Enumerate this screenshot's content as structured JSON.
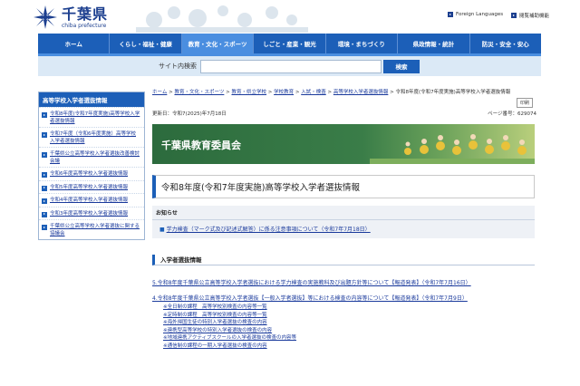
{
  "header": {
    "logo_jp": "千葉県",
    "logo_en": "chiba prefecture",
    "utility_links": [
      "Foreign Languages",
      "閲覧補助機能"
    ]
  },
  "nav": {
    "items": [
      "ホーム",
      "くらし・福祉・健康",
      "教育・文化・スポーツ",
      "しごと・産業・観光",
      "環境・まちづくり",
      "県政情報・統計",
      "防災・安全・安心"
    ],
    "active_index": 2
  },
  "search": {
    "label": "サイト内検索",
    "placeholder": "",
    "button": "検索"
  },
  "sidebar": {
    "title": "高等学校入学者選抜情報",
    "items": [
      {
        "label": "令和8年度(令和7年度実施)高等学校入学者選抜情報"
      },
      {
        "label": "令和7年度（令和6年度実施）高等学校入学者選抜情報"
      },
      {
        "label": "千葉県公立高等学校入学者選抜改善検討会議"
      },
      {
        "label": "令和6年度高等学校入学者選抜情報"
      },
      {
        "label": "令和5年度高等学校入学者選抜情報"
      },
      {
        "label": "令和4年度高等学校入学者選抜情報"
      },
      {
        "label": "令和3年度高等学校入学者選抜情報"
      },
      {
        "label": "千葉県公立高等学校入学者選抜に関する協議会"
      }
    ]
  },
  "main": {
    "breadcrumb": [
      "ホーム",
      "教育・文化・スポーツ",
      "教育・県立学校",
      "学校教育",
      "入試・検査",
      "高等学校入学者選抜情報",
      "令和8年度(令和7年度実施)高等学校入学者選抜情報"
    ],
    "updated": "更新日：令和7(2025)年7月18日",
    "page_number": "ページ番号：629074",
    "print_label": "印刷",
    "banner_title": "千葉県教育委員会",
    "page_title": "令和8年度(令和7年度実施)高等学校入学者選抜情報",
    "notice": {
      "heading": "お知らせ",
      "link": "学力検査（マーク式及び記述式解答）に係る注意事項について（令和7年7月18日）"
    },
    "section": {
      "heading": "入学者選抜情報",
      "item5": "5.令和8年度千葉県公立高等学校入学者選抜における学力検査の実施教科及び出題方針等について【報道発表】（令和7年7月16日）",
      "item4": "4.令和8年度千葉県公立高等学校入学者選抜【一般入学者選抜】等における検査の内容等について【報道発表】（令和7年7月9日）",
      "sub_items": [
        "※全日制の課程　高等学校別検査の内容等一覧",
        "※定時制の課程　高等学校別検査の内容等一覧",
        "※海外帰国生徒の特別入学者選抜の検査の内容",
        "※連携型高等学校の特別入学者選抜の検査の内容",
        "※地域連携アクティブスクールの入学者選抜の検査の内容等",
        "※通信制の課程の一期入学者選抜の検査の内容"
      ]
    }
  },
  "colors": {
    "nav_blue": "#1c5fb8",
    "nav_active": "#4a8ee0",
    "link": "#1a3a9c",
    "search_bg": "#dbe9f6",
    "banner_green": "#2c6b3d"
  }
}
